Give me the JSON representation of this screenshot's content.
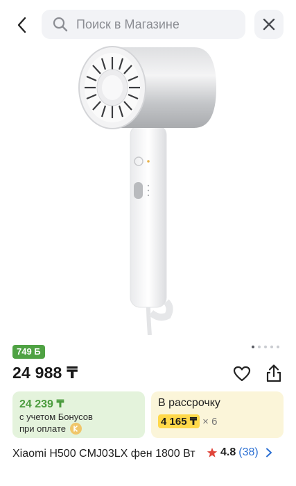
{
  "header": {
    "search_placeholder": "Поиск в Магазине"
  },
  "icons": {
    "back": "chevron-left-icon",
    "search": "search-icon",
    "close": "close-icon",
    "favorite": "heart-icon",
    "share": "share-icon",
    "star": "star-icon",
    "coin": "bonus-coin-icon",
    "more": "chevron-right-icon"
  },
  "product": {
    "bonus_badge": "749 Б",
    "price": "24 988 ₸",
    "title": "Xiaomi H500 CMJ03LX фен 1800 Вт",
    "rating": "4.8",
    "reviews": "(38)",
    "image_pages": 5,
    "current_image": 1
  },
  "bonus_card": {
    "price": "24 239 ₸",
    "line1": "с учетом Бонусов",
    "line2": "при оплате"
  },
  "credit_card": {
    "title": "В рассрочку",
    "amount": "4 165 ₸",
    "multiplier": "× 6"
  },
  "colors": {
    "accent_green": "#4fa243",
    "bonus_card_bg": "#e4f3dc",
    "credit_card_bg": "#fbf5d9",
    "credit_highlight": "#ffd84a",
    "link_blue": "#2b6fd3",
    "star_red": "#e0453a"
  }
}
